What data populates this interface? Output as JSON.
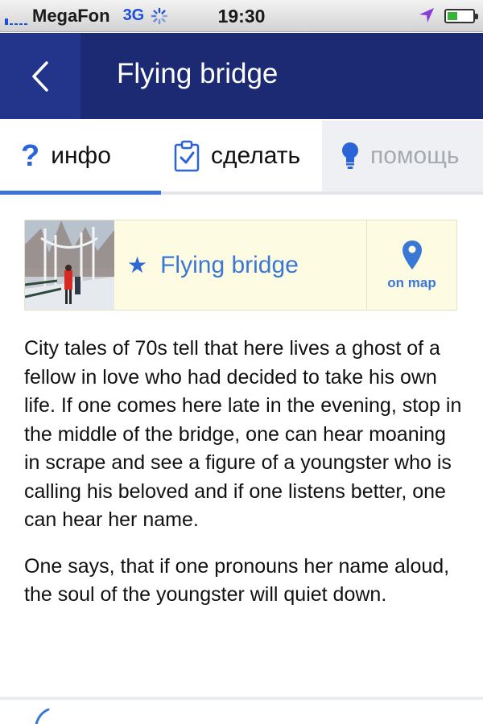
{
  "status_bar": {
    "carrier": "MegaFon",
    "network": "3G",
    "time": "19:30",
    "battery_level": 0.4,
    "icons": [
      "signal-icon",
      "loading-spinner-icon",
      "location-arrow-icon",
      "battery-icon"
    ]
  },
  "nav": {
    "title": "Flying bridge",
    "back_icon": "chevron-left-icon"
  },
  "tabs": [
    {
      "label": "инфо",
      "icon": "question-icon",
      "state": "selected"
    },
    {
      "label": "сделать",
      "icon": "checklist-icon",
      "state": "normal"
    },
    {
      "label": "помощь",
      "icon": "lightbulb-icon",
      "state": "disabled"
    }
  ],
  "place": {
    "name": "Flying bridge",
    "star_icon": "star-icon",
    "map_label": "on map",
    "map_icon": "map-pin-icon"
  },
  "description": {
    "paragraphs": [
      "City tales of 70s tell that here lives a ghost of a fellow in love who had decided to take his own life. If one comes here late in the evening, stop in the middle of the bridge, one can hear moaning in scrape and see a figure of a youngster who is calling his beloved and if one listens better, one can hear her name.",
      "One says, that if one pronouns her name aloud, the soul of the youngster will quiet down."
    ]
  },
  "colors": {
    "nav_background": "#1b2a72",
    "accent": "#3a74d8",
    "card_background": "#fefbe3"
  }
}
